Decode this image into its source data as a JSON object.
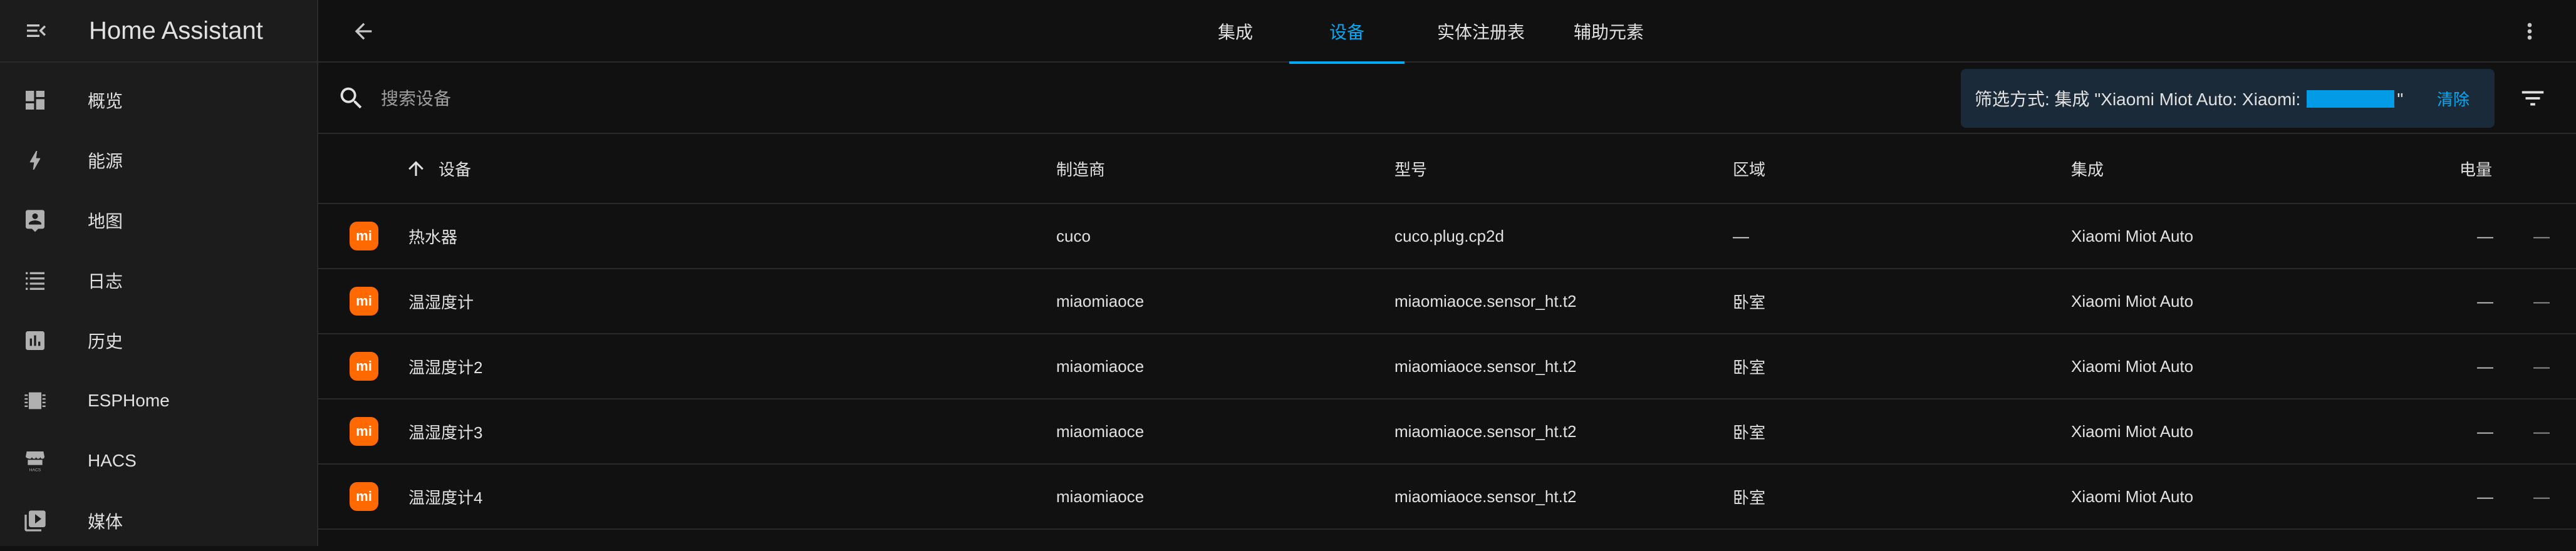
{
  "app": {
    "title": "Home Assistant"
  },
  "sidebar": {
    "items": [
      {
        "label": "概览",
        "icon": "dashboard-icon"
      },
      {
        "label": "能源",
        "icon": "lightning-icon"
      },
      {
        "label": "地图",
        "icon": "map-icon"
      },
      {
        "label": "日志",
        "icon": "logbook-icon"
      },
      {
        "label": "历史",
        "icon": "history-chart-icon"
      },
      {
        "label": "ESPHome",
        "icon": "esphome-icon"
      },
      {
        "label": "HACS",
        "icon": "hacs-icon"
      },
      {
        "label": "媒体",
        "icon": "media-play-icon"
      }
    ]
  },
  "tabs": [
    {
      "label": "集成",
      "active": false
    },
    {
      "label": "设备",
      "active": true
    },
    {
      "label": "实体注册表",
      "active": false
    },
    {
      "label": "辅助元素",
      "active": false
    }
  ],
  "search": {
    "placeholder": "搜索设备",
    "value": ""
  },
  "filter": {
    "prefix": "筛选方式: 集成 \"Xiaomi Miot Auto: Xiaomi:",
    "suffix": "\"",
    "clear_label": "清除",
    "redaction_color": "#039be5"
  },
  "columns": {
    "device": "设备",
    "manufacturer": "制造商",
    "model": "型号",
    "area": "区域",
    "integration": "集成",
    "battery": "电量"
  },
  "rows": [
    {
      "name": "热水器",
      "manufacturer": "cuco",
      "model": "cuco.plug.cp2d",
      "area": "—",
      "integration": "Xiaomi Miot Auto",
      "battery": "—",
      "extra": "—"
    },
    {
      "name": "温湿度计",
      "manufacturer": "miaomiaoce",
      "model": "miaomiaoce.sensor_ht.t2",
      "area": "卧室",
      "integration": "Xiaomi Miot Auto",
      "battery": "—",
      "extra": "—"
    },
    {
      "name": "温湿度计2",
      "manufacturer": "miaomiaoce",
      "model": "miaomiaoce.sensor_ht.t2",
      "area": "卧室",
      "integration": "Xiaomi Miot Auto",
      "battery": "—",
      "extra": "—"
    },
    {
      "name": "温湿度计3",
      "manufacturer": "miaomiaoce",
      "model": "miaomiaoce.sensor_ht.t2",
      "area": "卧室",
      "integration": "Xiaomi Miot Auto",
      "battery": "—",
      "extra": "—"
    },
    {
      "name": "温湿度计4",
      "manufacturer": "miaomiaoce",
      "model": "miaomiaoce.sensor_ht.t2",
      "area": "卧室",
      "integration": "Xiaomi Miot Auto",
      "battery": "—",
      "extra": "—"
    }
  ],
  "brand_logo_text": "mi",
  "colors": {
    "accent": "#03a9f4",
    "xiaomi_orange": "#ff6900",
    "background": "#111111",
    "sidebar": "#1c1c1c"
  }
}
